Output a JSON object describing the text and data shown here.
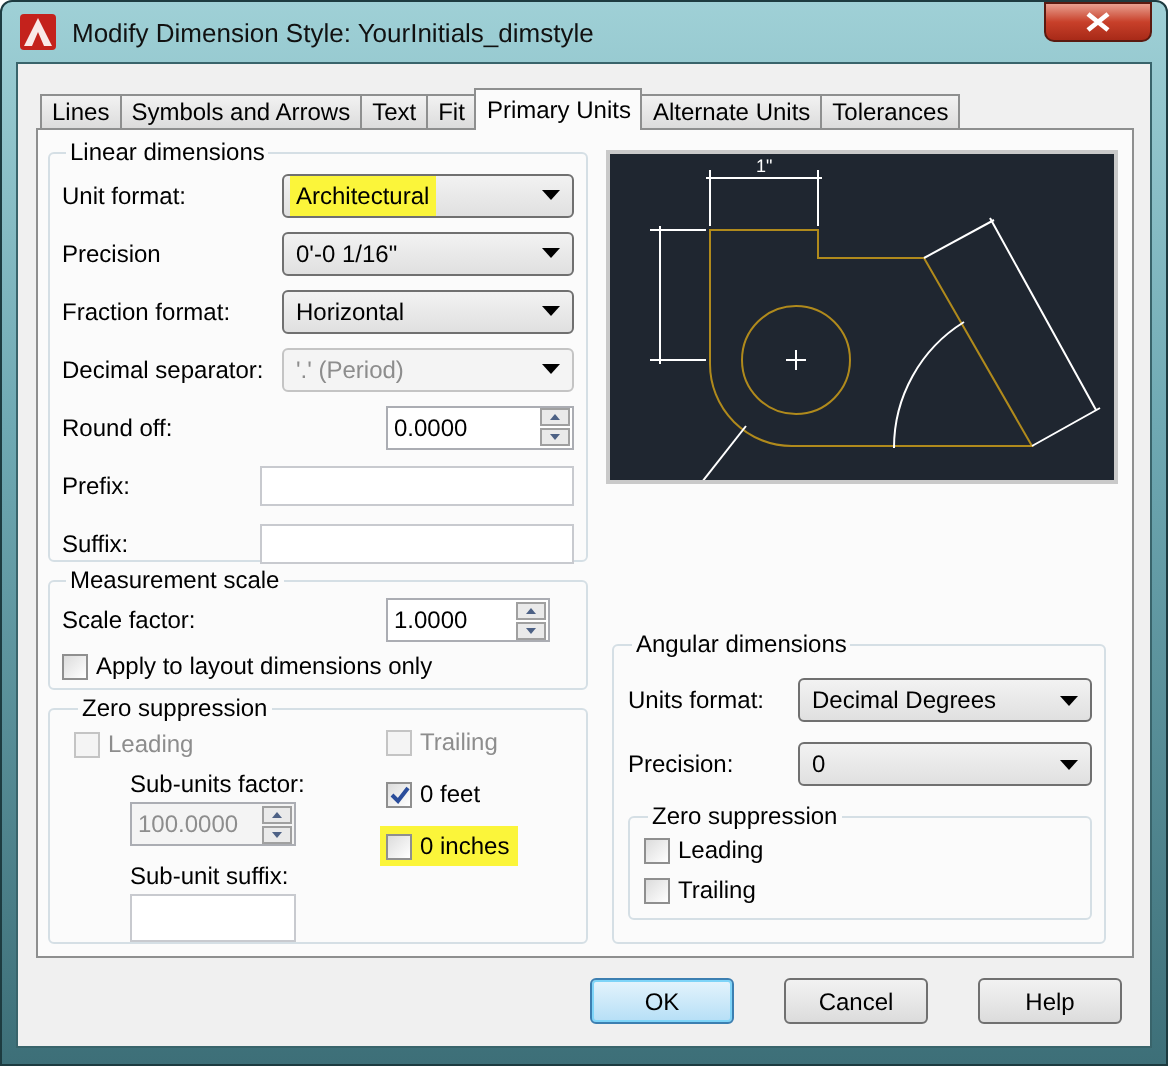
{
  "window": {
    "title": "Modify Dimension Style: YourInitials_dimstyle"
  },
  "tabs": [
    {
      "label": "Lines",
      "selected": false
    },
    {
      "label": "Symbols and Arrows",
      "selected": false
    },
    {
      "label": "Text",
      "selected": false
    },
    {
      "label": "Fit",
      "selected": false
    },
    {
      "label": "Primary Units",
      "selected": true
    },
    {
      "label": "Alternate Units",
      "selected": false
    },
    {
      "label": "Tolerances",
      "selected": false
    }
  ],
  "linear_dimensions": {
    "title": "Linear dimensions",
    "fields": [
      {
        "kind": "select",
        "label": "Unit format:",
        "value": "Architectural",
        "disabled": false,
        "highlighted": true
      },
      {
        "kind": "select",
        "label": "Precision",
        "value": "0'-0 1/16\"",
        "disabled": false
      },
      {
        "kind": "select",
        "label": "Fraction format:",
        "value": "Horizontal",
        "disabled": false
      },
      {
        "kind": "select",
        "label": "Decimal separator:",
        "value": "'.' (Period)",
        "disabled": true
      },
      {
        "kind": "spinner",
        "label": "Round off:",
        "value": "0.0000"
      },
      {
        "kind": "text",
        "label": "Prefix:"
      },
      {
        "kind": "text",
        "label": "Suffix:"
      }
    ]
  },
  "measurement_scale": {
    "title": "Measurement scale",
    "scale_factor": {
      "label": "Scale factor:",
      "value": "1.0000"
    },
    "apply_to_layout": {
      "label": "Apply to layout dimensions only",
      "checked": false
    }
  },
  "zero_suppression": {
    "title": "Zero suppression",
    "leading": {
      "label": "Leading",
      "checked": false,
      "disabled": true,
      "highlighted": false
    },
    "trailing": {
      "label": "Trailing",
      "checked": false,
      "disabled": true,
      "highlighted": false
    },
    "sub_units_factor": {
      "label": "Sub-units factor:",
      "value": "100.0000",
      "disabled": true
    },
    "sub_unit_suffix": {
      "label": "Sub-unit suffix:"
    },
    "zero_feet": {
      "label": "0 feet",
      "checked": true,
      "disabled": false,
      "highlighted": false
    },
    "zero_inches": {
      "label": "0 inches",
      "checked": false,
      "disabled": false,
      "highlighted": true
    }
  },
  "preview": {
    "dimension_label": "1\""
  },
  "angular_dimensions": {
    "title": "Angular dimensions",
    "units_format": {
      "label": "Units format:",
      "value": "Decimal Degrees"
    },
    "precision": {
      "label": "Precision:",
      "value": "0"
    },
    "zero_suppression": {
      "title": "Zero suppression",
      "options": [
        {
          "label": "Leading",
          "checked": false
        },
        {
          "label": "Trailing",
          "checked": false
        }
      ]
    }
  },
  "buttons": [
    {
      "label": "OK",
      "default": true
    },
    {
      "label": "Cancel",
      "default": false
    },
    {
      "label": "Help",
      "default": false
    }
  ]
}
